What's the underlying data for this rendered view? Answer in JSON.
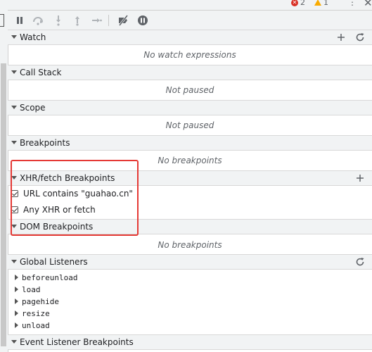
{
  "status": {
    "errors": "2",
    "warnings": "1",
    "more_icon": "more-vert-icon",
    "close_label": "✕"
  },
  "toolbar": {
    "buttons": [
      {
        "name": "pause-icon"
      },
      {
        "name": "step-over-icon"
      },
      {
        "name": "step-into-icon"
      },
      {
        "name": "step-out-icon"
      },
      {
        "name": "step-icon"
      },
      {
        "name": "deactivate-breakpoints-icon"
      },
      {
        "name": "pause-on-exceptions-icon"
      }
    ]
  },
  "sections": {
    "watch": {
      "title": "Watch",
      "empty": "No watch expressions"
    },
    "call_stack": {
      "title": "Call Stack",
      "empty": "Not paused"
    },
    "scope": {
      "title": "Scope",
      "empty": "Not paused"
    },
    "breakpoints": {
      "title": "Breakpoints",
      "empty": "No breakpoints"
    },
    "xhr": {
      "title": "XHR/fetch Breakpoints",
      "items": [
        {
          "label": "URL contains \"guahao.cn\"",
          "checked": true
        },
        {
          "label": "Any XHR or fetch",
          "checked": true
        }
      ]
    },
    "dom": {
      "title": "DOM Breakpoints",
      "empty": "No breakpoints"
    },
    "global_listeners": {
      "title": "Global Listeners",
      "items": [
        "beforeunload",
        "load",
        "pagehide",
        "resize",
        "unload"
      ]
    },
    "event_listener_breakpoints": {
      "title": "Event Listener Breakpoints"
    }
  },
  "colors": {
    "panel_bg": "#f1f3f4",
    "highlight": "#e53935",
    "error": "#d93025",
    "warning": "#f9ab00"
  }
}
